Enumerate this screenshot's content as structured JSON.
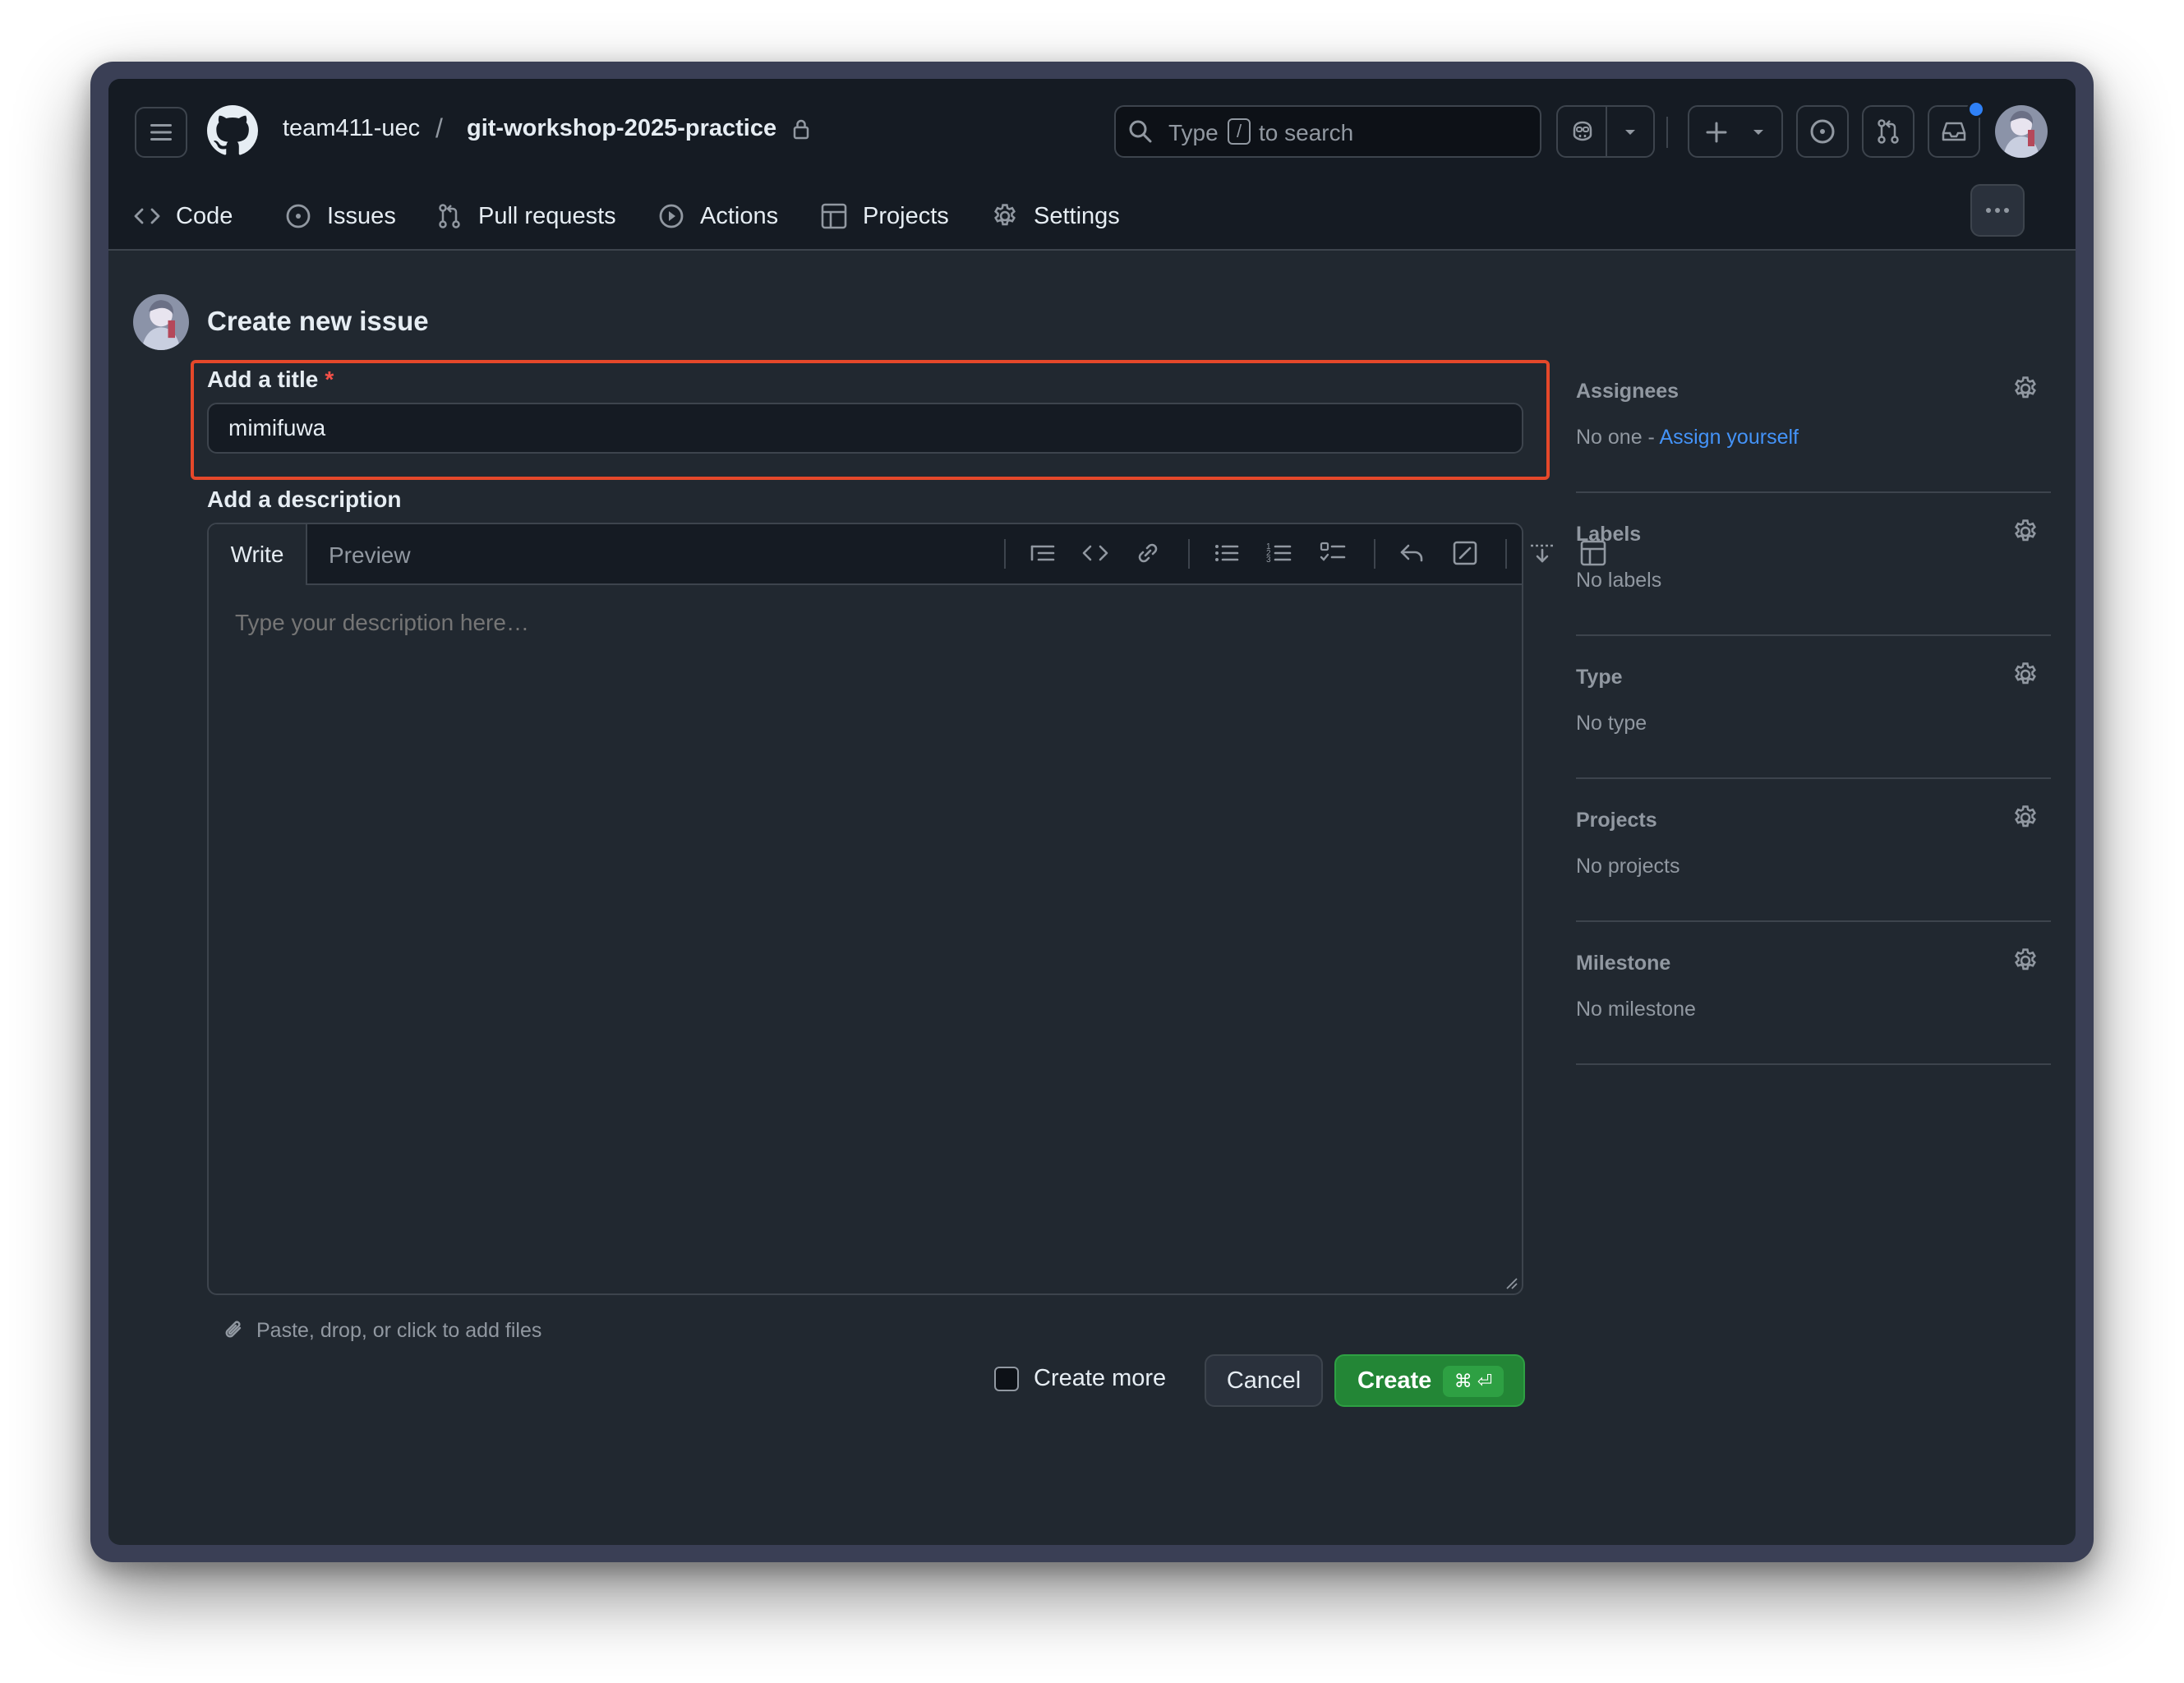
{
  "header": {
    "owner": "team411-uec",
    "separator": "/",
    "repo": "git-workshop-2025-practice",
    "search": {
      "prefix": "Type",
      "key": "/",
      "suffix": "to search"
    }
  },
  "nav_tabs": [
    {
      "label": "Code",
      "icon": "code-icon"
    },
    {
      "label": "Issues",
      "icon": "issue-opened-icon"
    },
    {
      "label": "Pull requests",
      "icon": "git-pull-request-icon"
    },
    {
      "label": "Actions",
      "icon": "play-icon"
    },
    {
      "label": "Projects",
      "icon": "table-icon"
    },
    {
      "label": "Settings",
      "icon": "gear-icon"
    }
  ],
  "page": {
    "title": "Create new issue",
    "title_label": "Add a title",
    "required_mark": "*",
    "title_value": "mimifuwa",
    "description_label": "Add a description",
    "editor_tabs": {
      "write": "Write",
      "preview": "Preview"
    },
    "description_placeholder": "Type your description here…",
    "attach_hint": "Paste, drop, or click to add files",
    "create_more": "Create more",
    "cancel": "Cancel",
    "create": "Create",
    "create_shortcut": "⌘ ⏎"
  },
  "sidebar": {
    "assignees": {
      "label": "Assignees",
      "value": "No one - ",
      "link": "Assign yourself"
    },
    "labels": {
      "label": "Labels",
      "value": "No labels"
    },
    "type": {
      "label": "Type",
      "value": "No type"
    },
    "projects": {
      "label": "Projects",
      "value": "No projects"
    },
    "milestone": {
      "label": "Milestone",
      "value": "No milestone"
    }
  },
  "colors": {
    "accent_green": "#238636",
    "link_blue": "#4493f8",
    "highlight_red": "#e5482a",
    "background": "#212830"
  }
}
